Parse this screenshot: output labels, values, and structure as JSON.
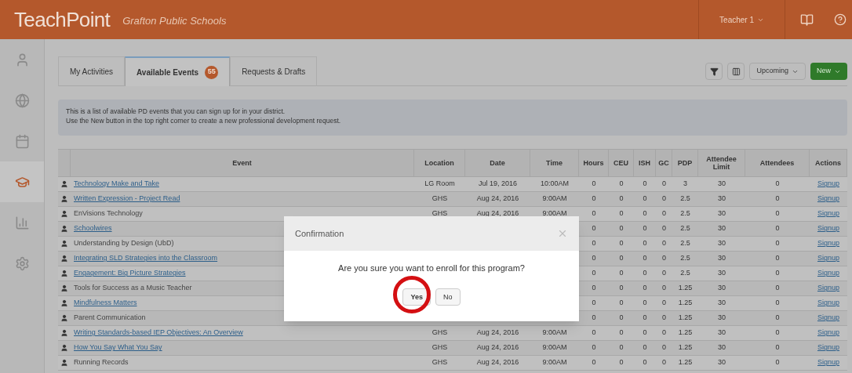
{
  "header": {
    "logo": "TeachPoint",
    "district": "Grafton Public Schools",
    "user_menu": "Teacher 1"
  },
  "sidebar": {
    "items": [
      {
        "kind": "user",
        "selected": false
      },
      {
        "kind": "globe",
        "selected": false
      },
      {
        "kind": "calendar",
        "selected": false
      },
      {
        "kind": "cap",
        "selected": true
      },
      {
        "kind": "chart",
        "selected": false
      },
      {
        "kind": "gear",
        "selected": false
      }
    ]
  },
  "tabs": [
    {
      "label": "My Activities",
      "selected": false
    },
    {
      "label": "Available Events",
      "badge": "55",
      "selected": true
    },
    {
      "label": "Requests & Drafts",
      "selected": false
    }
  ],
  "toolbar": {
    "view_menu": "Upcoming",
    "new_button": "New"
  },
  "info": [
    "This is a list of available PD events that you can sign up for in your district.",
    "Use the New button in the top right corner to create a new professional development request."
  ],
  "table": {
    "columns": [
      "Event",
      "Location",
      "Date",
      "Time",
      "Hours",
      "CEU",
      "ISH",
      "GC",
      "PDP",
      "Attendee Limit",
      "Attendees",
      "Actions"
    ],
    "rows": [
      {
        "event": "Technology Make and Take",
        "link": true,
        "location": "LG Room",
        "date": "Jul 19, 2016",
        "time": "10:00AM",
        "hours": "0",
        "ceu": "0",
        "ish": "0",
        "gc": "0",
        "pdp": "3",
        "limit": "30",
        "attendees": "0",
        "action": "Signup"
      },
      {
        "event": "Written Expression - Project Read",
        "link": true,
        "location": "GHS",
        "date": "Aug 24, 2016",
        "time": "9:00AM",
        "hours": "0",
        "ceu": "0",
        "ish": "0",
        "gc": "0",
        "pdp": "2.5",
        "limit": "30",
        "attendees": "0",
        "action": "Signup"
      },
      {
        "event": "EnVisions Technology",
        "link": false,
        "location": "GHS",
        "date": "Aug 24, 2016",
        "time": "9:00AM",
        "hours": "0",
        "ceu": "0",
        "ish": "0",
        "gc": "0",
        "pdp": "2.5",
        "limit": "30",
        "attendees": "0",
        "action": "Signup"
      },
      {
        "event": "Schoolwires",
        "link": true,
        "hours": "0",
        "ceu": "0",
        "ish": "0",
        "gc": "0",
        "pdp": "2.5",
        "limit": "30",
        "attendees": "0",
        "action": "Signup"
      },
      {
        "event": "Understanding by Design (UbD)",
        "link": false,
        "hours": "0",
        "ceu": "0",
        "ish": "0",
        "gc": "0",
        "pdp": "2.5",
        "limit": "30",
        "attendees": "0",
        "action": "Signup"
      },
      {
        "event": "Integrating SLD Strategies into the Classroom",
        "link": true,
        "hours": "0",
        "ceu": "0",
        "ish": "0",
        "gc": "0",
        "pdp": "2.5",
        "limit": "30",
        "attendees": "0",
        "action": "Signup"
      },
      {
        "event": "Engagement: Big Picture Strategies",
        "link": true,
        "hours": "0",
        "ceu": "0",
        "ish": "0",
        "gc": "0",
        "pdp": "2.5",
        "limit": "30",
        "attendees": "0",
        "action": "Signup"
      },
      {
        "event": "Tools for Success as a Music Teacher",
        "link": false,
        "hours": "0",
        "ceu": "0",
        "ish": "0",
        "gc": "0",
        "pdp": "1.25",
        "limit": "30",
        "attendees": "0",
        "action": "Signup"
      },
      {
        "event": "Mindfulness Matters",
        "link": true,
        "hours": "0",
        "ceu": "0",
        "ish": "0",
        "gc": "0",
        "pdp": "1.25",
        "limit": "30",
        "attendees": "0",
        "action": "Signup"
      },
      {
        "event": "Parent Communication",
        "link": false,
        "hours": "0",
        "ceu": "0",
        "ish": "0",
        "gc": "0",
        "pdp": "1.25",
        "limit": "30",
        "attendees": "0",
        "action": "Signup"
      },
      {
        "event": "Writing Standards-based IEP Objectives: An Overview",
        "link": true,
        "location": "GHS",
        "date": "Aug 24, 2016",
        "time": "9:00AM",
        "hours": "0",
        "ceu": "0",
        "ish": "0",
        "gc": "0",
        "pdp": "1.25",
        "limit": "30",
        "attendees": "0",
        "action": "Signup"
      },
      {
        "event": "How You Say What You Say",
        "link": true,
        "location": "GHS",
        "date": "Aug 24, 2016",
        "time": "9:00AM",
        "hours": "0",
        "ceu": "0",
        "ish": "0",
        "gc": "0",
        "pdp": "1.25",
        "limit": "30",
        "attendees": "0",
        "action": "Signup"
      },
      {
        "event": "Running Records",
        "link": false,
        "location": "GHS",
        "date": "Aug 24, 2016",
        "time": "9:00AM",
        "hours": "0",
        "ceu": "0",
        "ish": "0",
        "gc": "0",
        "pdp": "1.25",
        "limit": "30",
        "attendees": "0",
        "action": "Signup"
      }
    ]
  },
  "dialog": {
    "title": "Confirmation",
    "message": "Are you sure you want to enroll for this program?",
    "buttons": [
      {
        "label": "Yes",
        "circled": true
      },
      {
        "label": "No",
        "circled": false
      }
    ]
  }
}
